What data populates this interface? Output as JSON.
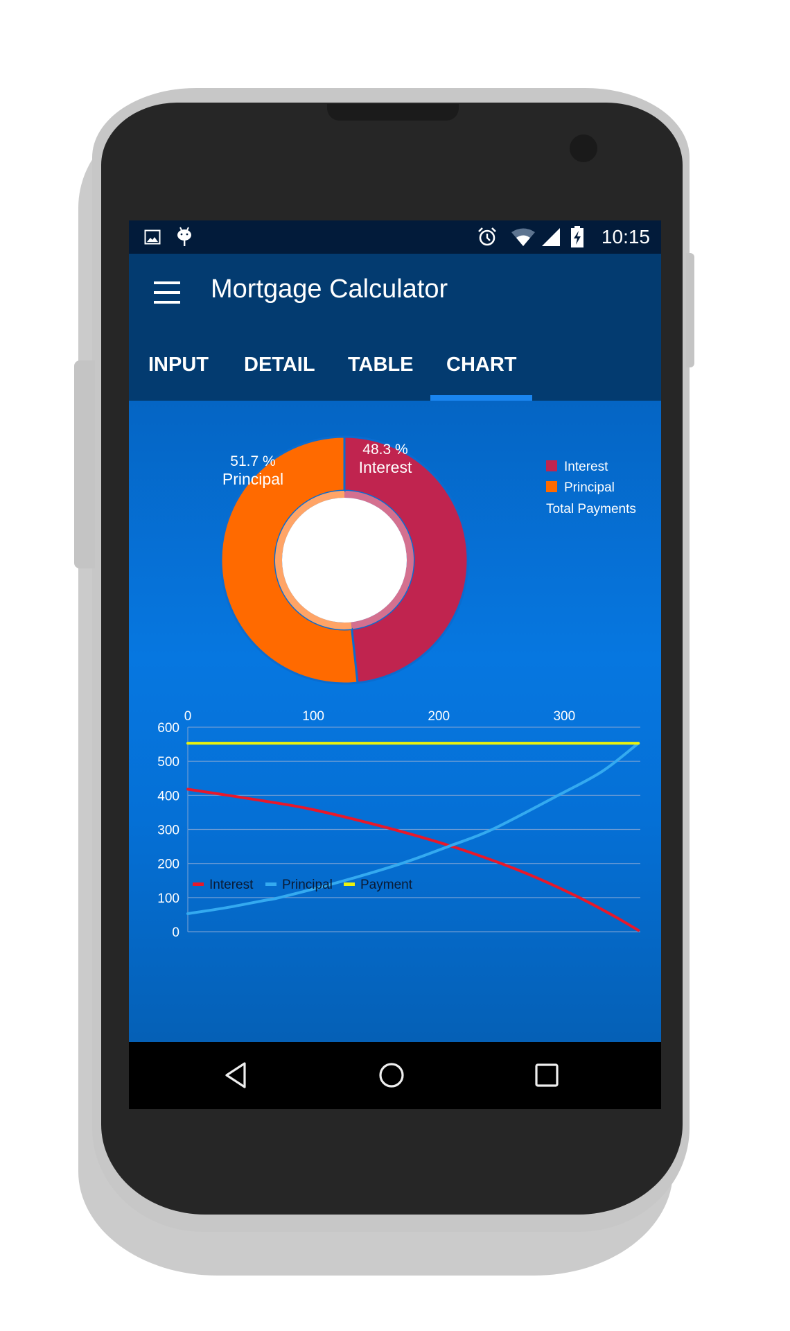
{
  "status_bar": {
    "left_icons": [
      "image-notification-icon",
      "android-debug-icon"
    ],
    "right_icons": [
      "alarm-icon",
      "wifi-icon",
      "cell-signal-icon",
      "battery-charging-icon"
    ],
    "time": "10:15"
  },
  "app_bar": {
    "menu_icon": "hamburger-menu-icon",
    "title": "Mortgage Calculator",
    "tabs": [
      {
        "label": "INPUT",
        "selected": false
      },
      {
        "label": "DETAIL",
        "selected": false
      },
      {
        "label": "TABLE",
        "selected": false
      },
      {
        "label": "CHART",
        "selected": true
      }
    ]
  },
  "nav_bar": {
    "back_icon": "back-triangle-icon",
    "home_icon": "home-circle-icon",
    "recents_icon": "recents-square-icon"
  },
  "colors": {
    "interest": "#c0244f",
    "principal": "#ff6a00",
    "line_interest": "#e8182a",
    "line_principal": "#34aaf0",
    "line_payment": "#eaf20c",
    "status_bar": "#021b3a",
    "app_bar": "#033b70",
    "tab_indicator": "#1a85f0"
  },
  "chart_data": [
    {
      "type": "pie",
      "style": "donut",
      "title": "Total Payments",
      "slices": [
        {
          "label": "Interest",
          "value": 48.3,
          "display": "48.3 %",
          "color": "#c0244f"
        },
        {
          "label": "Principal",
          "value": 51.7,
          "display": "51.7 %",
          "color": "#ff6a00"
        }
      ],
      "legend": {
        "position": "right",
        "entries": [
          "Interest",
          "Principal"
        ],
        "caption": "Total Payments"
      }
    },
    {
      "type": "line",
      "title": "",
      "xlabel": "",
      "ylabel": "",
      "xlim": [
        0,
        360
      ],
      "ylim": [
        0,
        600
      ],
      "x_ticks": [
        0,
        100,
        200,
        300
      ],
      "x_axis_position": "top",
      "y_ticks": [
        0,
        100,
        200,
        300,
        400,
        500,
        600
      ],
      "grid": true,
      "legend": {
        "position": "bottom-left",
        "entries": [
          "Interest",
          "Principal",
          "Payment"
        ]
      },
      "series": [
        {
          "name": "Interest",
          "color": "#e8182a",
          "points": [
            [
              0,
              418
            ],
            [
              60,
              384
            ],
            [
              100,
              358
            ],
            [
              161,
              303
            ],
            [
              209,
              252
            ],
            [
              249,
              201
            ],
            [
              280,
              155
            ],
            [
              312,
              100
            ],
            [
              340,
              45
            ],
            [
              359,
              4
            ]
          ]
        },
        {
          "name": "Principal",
          "color": "#34aaf0",
          "points": [
            [
              0,
              53
            ],
            [
              30,
              70
            ],
            [
              60,
              91
            ],
            [
              73,
              100
            ],
            [
              120,
              145
            ],
            [
              171,
              201
            ],
            [
              209,
              252
            ],
            [
              242,
              299
            ],
            [
              295,
              400
            ],
            [
              330,
              470
            ],
            [
              359,
              553
            ]
          ]
        },
        {
          "name": "Payment",
          "color": "#eaf20c",
          "points": [
            [
              0,
              553
            ],
            [
              359,
              553
            ]
          ]
        }
      ]
    }
  ]
}
